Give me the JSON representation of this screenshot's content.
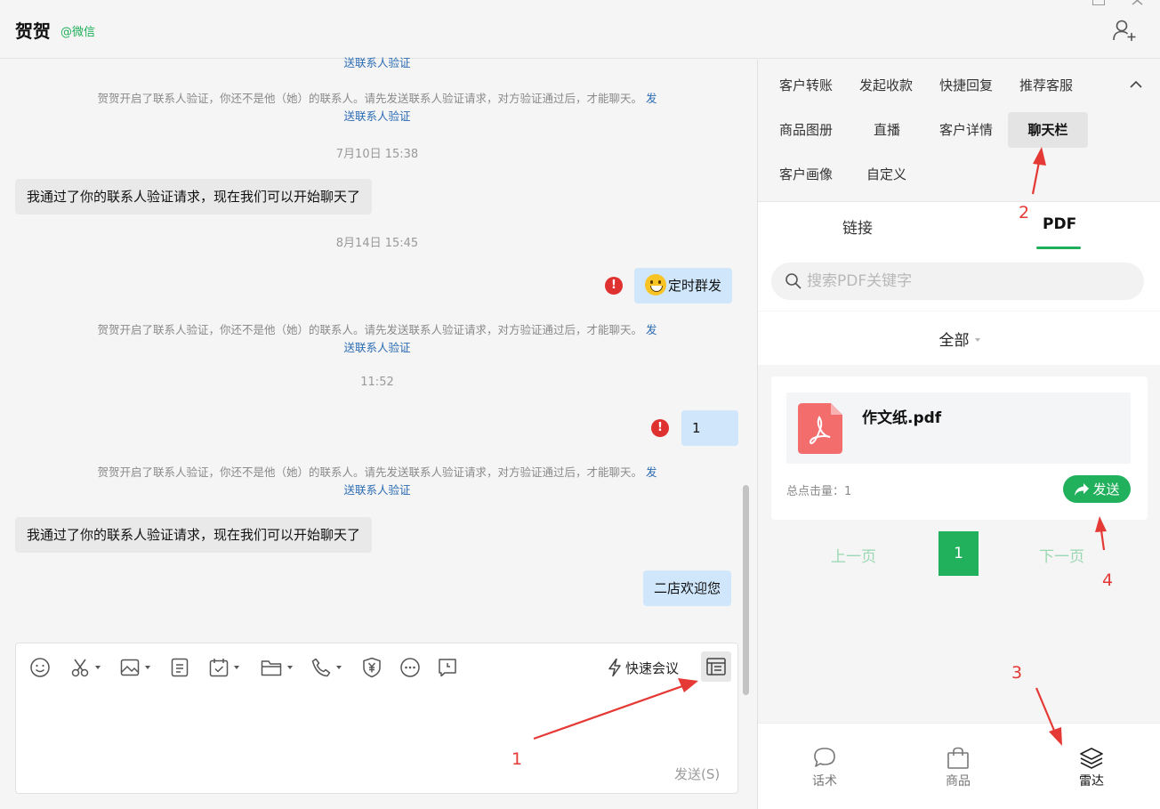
{
  "header": {
    "title": "贺贺",
    "tag": "@微信"
  },
  "chat": {
    "top_link": "送联系人验证",
    "sys_text": "贺贺开启了联系人验证，你还不是他（她）的联系人。请先发送联系人验证请求，对方验证通过后，才能聊天。",
    "sys_link_1": "发",
    "sys_link_2": "送联系人验证",
    "time_1": "7月10日 15:38",
    "msg_in_1": "我通过了你的联系人验证请求，现在我们可以开始聊天了",
    "time_2": "8月14日 15:45",
    "msg_out_1": "定时群发",
    "time_3": "11:52",
    "msg_out_2": "1",
    "msg_in_2": "我通过了你的联系人验证请求，现在我们可以开始聊天了",
    "msg_out_3": "二店欢迎您",
    "warn_glyph": "!"
  },
  "input": {
    "quick_meeting": "快速会议",
    "send": "发送(S)"
  },
  "panel": {
    "top_tabs": [
      "客户转账",
      "发起收款",
      "快捷回复",
      "推荐客服",
      "商品图册",
      "直播",
      "客户详情",
      "聊天栏",
      "客户画像",
      "自定义"
    ],
    "active_top_tab": "聊天栏",
    "sub_tabs": [
      "链接",
      "PDF"
    ],
    "active_sub_tab": "PDF",
    "search_placeholder": "搜索PDF关键字",
    "filter": "全部",
    "file": {
      "name": "作文纸.pdf",
      "clicks": "总点击量：1",
      "send": "发送"
    },
    "pager": {
      "prev": "上一页",
      "current": "1",
      "next": "下一页"
    },
    "bottom_nav": [
      "话术",
      "商品",
      "雷达"
    ],
    "active_bottom_nav": "雷达"
  },
  "annotations": [
    "1",
    "2",
    "3",
    "4"
  ],
  "colors": {
    "accent_green": "#21b15d",
    "annotation_red": "#e53935",
    "bubble_out": "#cfe6fb",
    "warn_red": "#e03131"
  }
}
